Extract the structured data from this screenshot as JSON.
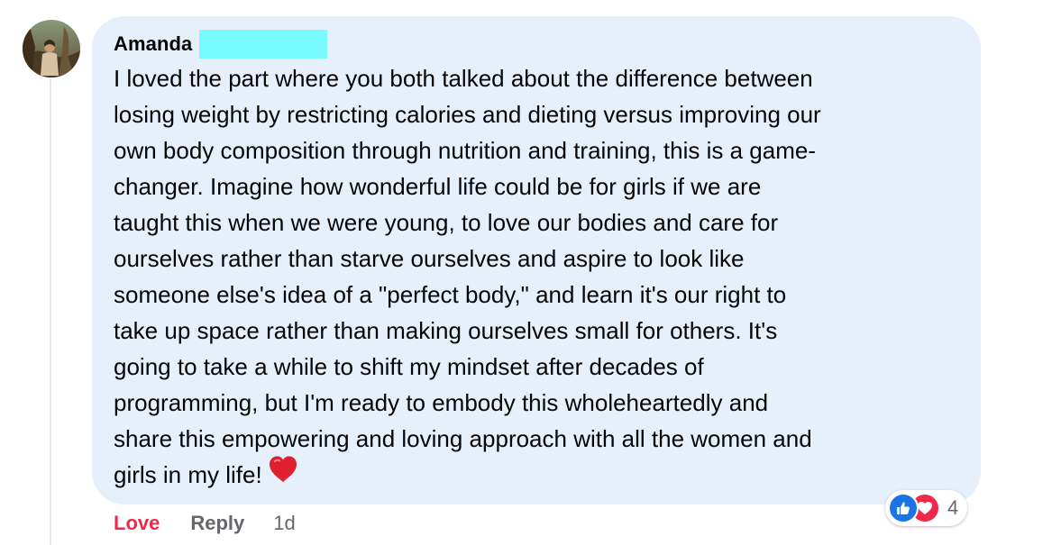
{
  "comment": {
    "author": "Amanda",
    "text_lines": [
      "I loved the part where you both talked about the difference between",
      "losing weight by restricting calories and dieting versus improving our",
      "own body composition through nutrition and training, this is a game-",
      "changer. Imagine how wonderful life could be for girls if we are",
      "taught this when we were young, to love our bodies and care for",
      "ourselves rather than starve ourselves and aspire to look like",
      "someone else's idea of a \"perfect body,\" and learn it's our right to",
      "take up space rather than making ourselves small for others. It's",
      "going to take a while to shift my mindset after decades of",
      "programming, but I'm ready to embody this wholeheartedly and",
      "share this empowering and loving approach with all the women and",
      "girls in my life!"
    ],
    "emoji_icon": "red-heart-emoji",
    "reactions": {
      "icons": [
        "like-reaction-icon",
        "love-reaction-icon"
      ],
      "count": "4"
    },
    "actions": {
      "love_label": "Love",
      "reply_label": "Reply",
      "timestamp": "1d"
    }
  },
  "colors": {
    "bubble_bg": "#e6f0fb",
    "love_accent": "#f0284a",
    "like_blue": "#1b74e4",
    "muted_text": "#65676b",
    "redaction": "#78fbff"
  }
}
